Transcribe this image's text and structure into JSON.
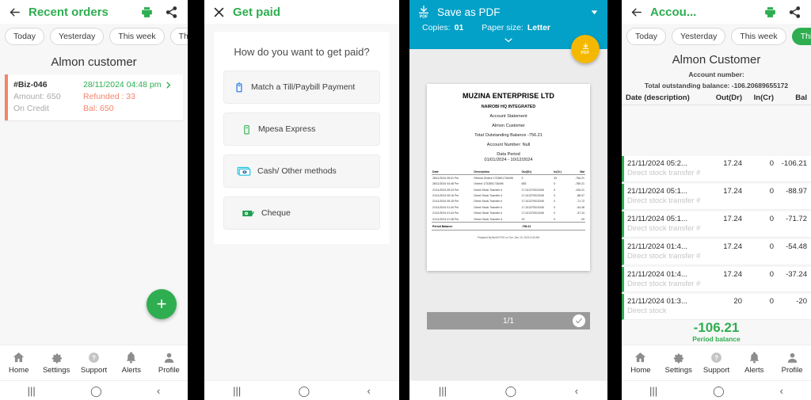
{
  "panel1": {
    "appbar": {
      "title": "Recent orders",
      "back_icon": "arrow-left-icon",
      "print_icon": "printer-icon",
      "share_icon": "share-icon"
    },
    "chips": [
      {
        "label": "Today",
        "active": false
      },
      {
        "label": "Yesterday",
        "active": false
      },
      {
        "label": "This week",
        "active": false
      },
      {
        "label": "This m",
        "active": false
      }
    ],
    "customer_name": "Almon customer",
    "order": {
      "id": "#Biz-046",
      "amount": "Amount: 650",
      "credit": "On Credit",
      "date": "28/11/2024 04:48 pm",
      "refunded": "Refunded :  33",
      "balance": "Bal:  650",
      "chevron_icon": "chevron-right-icon"
    },
    "fab_label": "+",
    "nav": [
      {
        "label": "Home",
        "icon": "home-icon"
      },
      {
        "label": "Settings",
        "icon": "gear-icon"
      },
      {
        "label": "Support",
        "icon": "question-circle-icon"
      },
      {
        "label": "Alerts",
        "icon": "bell-icon"
      },
      {
        "label": "Profile",
        "icon": "person-icon"
      }
    ]
  },
  "panel2": {
    "appbar": {
      "title": "Get paid",
      "close_icon": "close-icon"
    },
    "question": "How do you want to get paid?",
    "options": [
      {
        "label": "Match a Till/Paybill Payment",
        "icon": "mobile-payment-icon"
      },
      {
        "label": "Mpesa Express",
        "icon": "feature-phone-icon"
      },
      {
        "label": "Cash/ Other methods",
        "icon": "cash-stack-icon"
      },
      {
        "label": "Cheque",
        "icon": "cheque-icon"
      }
    ]
  },
  "panel3": {
    "topbar": {
      "title": "Save as PDF",
      "pdf_icon": "save-pdf-icon",
      "dropdown_icon": "chevron-down-icon",
      "copies_label": "Copies:",
      "copies_value": "01",
      "paper_label": "Paper size:",
      "paper_value": "Letter",
      "expand_icon": "chevron-down-icon"
    },
    "fab": {
      "icon": "download-icon",
      "label": "PDF"
    },
    "document": {
      "company": "MUZINA ENTERPRISE LTD",
      "branch": "NAIROBI HQ INTEGRATED",
      "doc_type": "Account Statement",
      "customer": "Almon Customer",
      "outstanding": "Total Outstanding Balance -756.21",
      "account_number": "Account Number: Null",
      "period_label": "Data Period",
      "period_value": "01/01/2024 - 10/12/2024",
      "columns": [
        "Date",
        "Description",
        "Out(Dr)",
        "In(Cr)",
        "Bal"
      ],
      "rows": [
        [
          "28/11/2024 05:01 Pm",
          "Refund Order# 1732801726496",
          "0",
          "33",
          "-756.21"
        ],
        [
          "28/11/2024 04:48 Pm",
          "Order# 1732801726496",
          "683",
          "0",
          "-789.21"
        ],
        [
          "21/11/2024 05:23 Pm",
          "Direct Stock Transfer #",
          "17.241379310345",
          "0",
          "-106.21"
        ],
        [
          "21/11/2024 05:16 Pm",
          "Direct Stock Transfer #",
          "17.241379310345",
          "0",
          "-88.97"
        ],
        [
          "21/11/2024 05:15 Pm",
          "Direct Stock Transfer #",
          "17.241379310345",
          "0",
          "-71.72"
        ],
        [
          "21/11/2024 01:40 Pm",
          "Direct Stock Transfer #",
          "17.241379310345",
          "0",
          "-54.48"
        ],
        [
          "21/11/2024 01:44 Pm",
          "Direct Stock Transfer #",
          "17.241379310345",
          "0",
          "-37.24"
        ],
        [
          "21/11/2024 01:38 Pm",
          "Direct Stock Transfer #",
          "20",
          "0",
          "-20"
        ]
      ],
      "total_label": "Period Balance",
      "total_value": "-756.21",
      "footer": "Prepared By BizKit POS on Tue, Dec 10, 2024 9:40 AM"
    },
    "pager": {
      "text": "1/1",
      "confirm_icon": "check-icon"
    }
  },
  "panel4": {
    "appbar": {
      "title": "Accou...",
      "back_icon": "arrow-left-icon",
      "print_icon": "printer-icon",
      "share_icon": "share-icon"
    },
    "chips": [
      {
        "label": "Today",
        "active": false
      },
      {
        "label": "Yesterday",
        "active": false
      },
      {
        "label": "This week",
        "active": false
      },
      {
        "label": "This m",
        "active": true
      }
    ],
    "customer_name": "Almon Customer",
    "account_number": "Account number:",
    "outstanding": "Total outstanding balance: -106.20689655172",
    "columns": [
      "Date (description)",
      "Out(Dr)",
      "In(Cr)",
      "Bal"
    ],
    "rows": [
      {
        "date": "21/11/2024 05:2...",
        "desc": "Direct stock transfer #",
        "out": "17.24",
        "in": "0",
        "bal": "-106.21"
      },
      {
        "date": "21/11/2024 05:1...",
        "desc": "Direct stock transfer #",
        "out": "17.24",
        "in": "0",
        "bal": "-88.97"
      },
      {
        "date": "21/11/2024 05:1...",
        "desc": "Direct stock transfer #",
        "out": "17.24",
        "in": "0",
        "bal": "-71.72"
      },
      {
        "date": "21/11/2024 01:4...",
        "desc": "Direct stock transfer #",
        "out": "17.24",
        "in": "0",
        "bal": "-54.48"
      },
      {
        "date": "21/11/2024 01:4...",
        "desc": "Direct stock transfer #",
        "out": "17.24",
        "in": "0",
        "bal": "-37.24"
      },
      {
        "date": "21/11/2024 01:3...",
        "desc": "Direct stock",
        "out": "20",
        "in": "0",
        "bal": "-20"
      }
    ],
    "period_balance_value": "-106.21",
    "period_balance_label": "Period balance",
    "nav": [
      {
        "label": "Home",
        "icon": "home-icon"
      },
      {
        "label": "Settings",
        "icon": "gear-icon"
      },
      {
        "label": "Support",
        "icon": "question-circle-icon"
      },
      {
        "label": "Alerts",
        "icon": "bell-icon"
      },
      {
        "label": "Profile",
        "icon": "person-icon"
      }
    ]
  },
  "sysbar": {
    "recents_icon": "recents-icon",
    "home_icon": "home-circle-icon",
    "back_icon": "back-chevron-icon"
  },
  "colors": {
    "brand_green": "#2eae50",
    "pdf_blue": "#03a0c7",
    "pdf_yellow": "#f5b800",
    "refund_orange": "#f4846b"
  }
}
